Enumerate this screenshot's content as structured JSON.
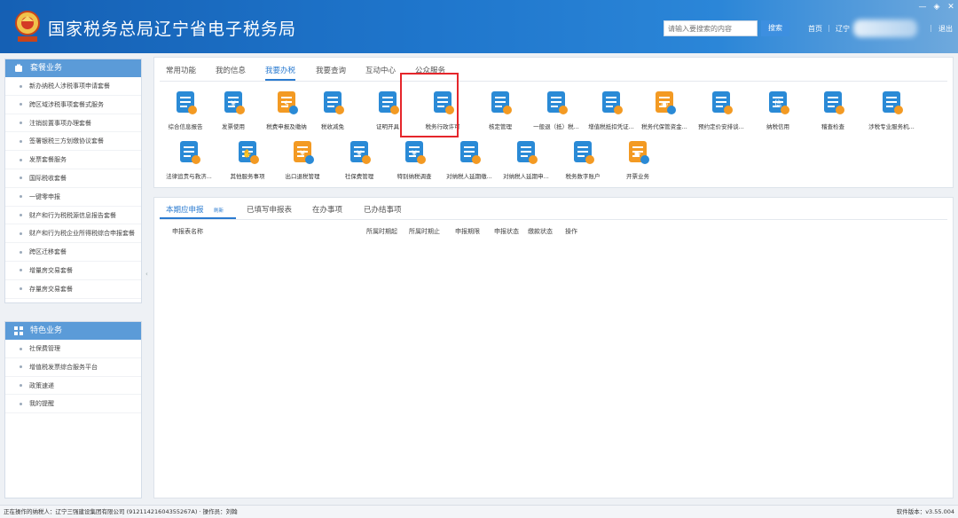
{
  "colors": {
    "brand": "#1a6ec2",
    "accent": "#2b7bd0",
    "highlight": "#e5262b",
    "sidebar_header": "#5b9bd8"
  },
  "header": {
    "title": "国家税务总局辽宁省电子税务局",
    "logo_icon": "tax-emblem-icon",
    "search_placeholder": "请输入要搜索的内容",
    "search_label": "搜索",
    "home_link": "首页",
    "region": "辽宁",
    "logout": "退出",
    "window_controls": [
      "—",
      "◈",
      "✕"
    ]
  },
  "sidebar": {
    "package_section": {
      "title": "套餐业务",
      "items": [
        "新办纳税人涉税事项申请套餐",
        "跨区域涉税事项套餐式服务",
        "注销前置事项办理套餐",
        "签署银税三方划缴协议套餐",
        "发票套餐服务",
        "国际税收套餐",
        "一键零申报",
        "财产和行为税税源信息报告套餐",
        "财产和行为税企业所得税综合申报套餐",
        "跨区迁移套餐",
        "增量房交易套餐",
        "存量房交易套餐"
      ]
    },
    "feature_section": {
      "title": "特色业务",
      "items": [
        "社保费管理",
        "增值税发票综合服务平台",
        "政策速递",
        "我的提醒"
      ]
    },
    "collapse_glyph": "‹"
  },
  "main": {
    "tabs": [
      "常用功能",
      "我的信息",
      "我要办税",
      "我要查询",
      "互动中心",
      "公众服务"
    ],
    "active_tab": 2,
    "tiles": [
      {
        "label": "综合信息报告",
        "icon": "document-info-icon",
        "color": "#2a8ad6"
      },
      {
        "label": "发票使用",
        "icon": "invoice-icon",
        "color": "#2a8ad6"
      },
      {
        "label": "税费申报及缴纳",
        "icon": "tax-payment-icon",
        "color": "#f39a23"
      },
      {
        "label": "税收减免",
        "icon": "tax-reduction-icon",
        "color": "#2a8ad6"
      },
      {
        "label": "证明开具",
        "icon": "certificate-icon",
        "color": "#2a8ad6"
      },
      {
        "label": "税务行政许可",
        "icon": "license-icon",
        "color": "#2a8ad6"
      },
      {
        "label": "核定管理",
        "icon": "verification-icon",
        "color": "#2a8ad6"
      },
      {
        "label": "一般退（抵）税...",
        "icon": "tax-refund-icon",
        "color": "#2a8ad6"
      },
      {
        "label": "增值税抵扣凭证...",
        "icon": "vat-deduction-icon",
        "color": "#2a8ad6"
      },
      {
        "label": "税务代保管资金...",
        "icon": "custody-fund-icon",
        "color": "#f39a23"
      },
      {
        "label": "预约定价安排谈...",
        "icon": "pricing-arrangement-icon",
        "color": "#2a8ad6"
      },
      {
        "label": "纳税信用",
        "icon": "tax-credit-icon",
        "color": "#2a8ad6"
      },
      {
        "label": "稽查检查",
        "icon": "inspection-icon",
        "color": "#2a8ad6"
      },
      {
        "label": "涉税专业服务机...",
        "icon": "professional-service-icon",
        "color": "#2a8ad6"
      },
      {
        "label": "法律追责与救济...",
        "icon": "legal-remedy-icon",
        "color": "#2a8ad6"
      },
      {
        "label": "其他服务事项",
        "icon": "handshake-icon",
        "color": "#2a8ad6"
      },
      {
        "label": "出口退税管理",
        "icon": "export-rebate-icon",
        "color": "#f39a23"
      },
      {
        "label": "社保费管理",
        "icon": "social-security-icon",
        "color": "#2a8ad6"
      },
      {
        "label": "特别纳税调查",
        "icon": "special-investigation-icon",
        "color": "#2a8ad6"
      },
      {
        "label": "对纳税人延期缴...",
        "icon": "deferred-payment-icon",
        "color": "#2a8ad6"
      },
      {
        "label": "对纳税人延期申...",
        "icon": "deferred-filing-icon",
        "color": "#2a8ad6"
      },
      {
        "label": "税务数字账户",
        "icon": "digital-account-icon",
        "color": "#2a8ad6"
      },
      {
        "label": "开票业务",
        "icon": "invoicing-icon",
        "color": "#f39a23"
      }
    ]
  },
  "declarations": {
    "tabs": [
      "本期应申报",
      "已填写申报表",
      "在办事项",
      "已办结事项"
    ],
    "refresh_label": "刷新",
    "columns": [
      "申报表名称",
      "所属时期起",
      "所属时期止",
      "申报期限",
      "申报状态",
      "缴款状态",
      "操作"
    ]
  },
  "statusbar": {
    "left": "正在操作的纳税人：辽宁三强建设集团有限公司 (91211421604355267A) · 操作员：刘翰",
    "right": "软件版本：v3.55.004"
  }
}
